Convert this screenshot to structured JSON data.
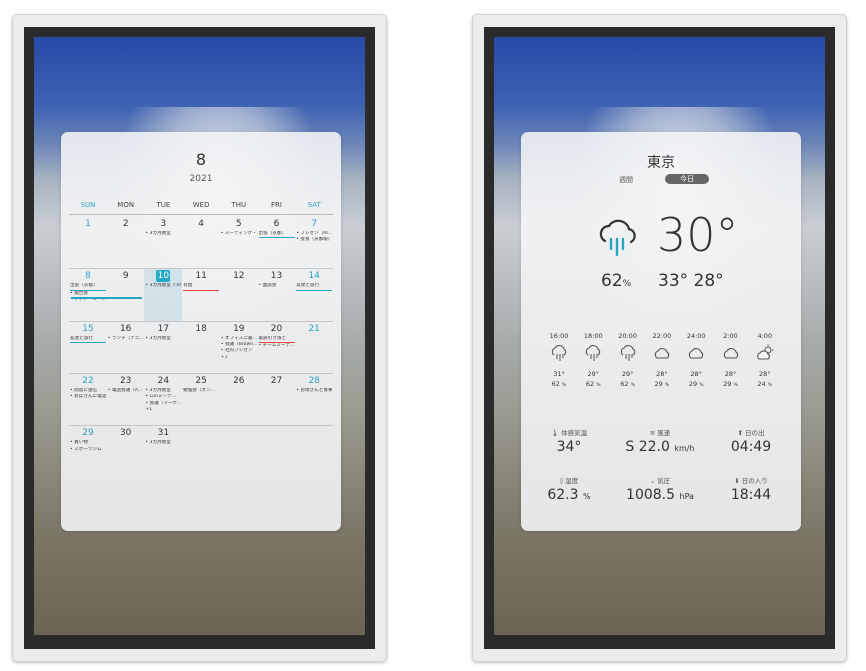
{
  "calendar": {
    "month": "8",
    "year": "2021",
    "weekdays": [
      "SUN",
      "MON",
      "TUE",
      "WED",
      "THU",
      "FRI",
      "SAT"
    ],
    "weeks": [
      [
        {
          "day": "1",
          "events": []
        },
        {
          "day": "2",
          "events": []
        },
        {
          "day": "3",
          "events": [
            "• 3カ月教室"
          ]
        },
        {
          "day": "4",
          "events": []
        },
        {
          "day": "5",
          "events": [
            "• ミーティング・"
          ]
        },
        {
          "day": "6",
          "events": [
            "出張（京都）"
          ]
        },
        {
          "day": "7",
          "events": [
            "• プレゼン（Al...",
            "• 会食（京都駅）"
          ]
        }
      ],
      [
        {
          "day": "8",
          "events": [
            "出張（京都）",
            "• 報告会",
            "• ディナーミー..."
          ]
        },
        {
          "day": "9",
          "events": []
        },
        {
          "day": "10",
          "events": [
            "• 3カ月教室 7:00a"
          ]
        },
        {
          "day": "11",
          "events": [
            "有給"
          ]
        },
        {
          "day": "12",
          "events": []
        },
        {
          "day": "13",
          "events": [
            "• 面談会"
          ]
        },
        {
          "day": "14",
          "events": [
            "友達と旅行"
          ]
        }
      ],
      [
        {
          "day": "15",
          "events": [
            "友達と旅行"
          ]
        },
        {
          "day": "16",
          "events": [
            "• ランチ（テニ..."
          ]
        },
        {
          "day": "17",
          "events": [
            "• 3カ月教室"
          ]
        },
        {
          "day": "18",
          "events": []
        },
        {
          "day": "19",
          "events": [
            "• オフィスに書...",
            "• 会議（Brown...",
            "• 社内プレゼン",
            "+1"
          ]
        },
        {
          "day": "20",
          "events": [
            "家族引き落と",
            "• チームミーテ..."
          ]
        },
        {
          "day": "21",
          "events": []
        }
      ],
      [
        {
          "day": "22",
          "events": [
            "• 間島に送信",
            "• おばさんに電話"
          ]
        },
        {
          "day": "23",
          "events": [
            "• 電話会議（A..."
          ]
        },
        {
          "day": "24",
          "events": [
            "• 3カ月教室",
            "• Lunミーテ...",
            "• 会議（マーケ...",
            "+1"
          ]
        },
        {
          "day": "25",
          "events": [
            "勉強会（オン..."
          ]
        },
        {
          "day": "26",
          "events": []
        },
        {
          "day": "27",
          "events": []
        },
        {
          "day": "28",
          "events": [
            "• お母さんと食事"
          ]
        }
      ],
      [
        {
          "day": "29",
          "events": [
            "• 買い物",
            "• スポーツジム"
          ]
        },
        {
          "day": "30",
          "events": []
        },
        {
          "day": "31",
          "events": [
            "• 3カ月教室"
          ]
        }
      ]
    ]
  },
  "weather": {
    "city": "東京",
    "tab_week": "週間",
    "tab_today": "今日",
    "current_icon": "rain-cloud-icon",
    "current_temp": "30°",
    "precip": "62",
    "precip_unit": "%",
    "hilo": "33° 28°",
    "hourly": [
      {
        "time": "16:00",
        "icon": "rain-cloud-icon",
        "temp": "31°",
        "pct": "62"
      },
      {
        "time": "18:00",
        "icon": "rain-cloud-icon",
        "temp": "29°",
        "pct": "62"
      },
      {
        "time": "20:00",
        "icon": "rain-cloud-icon",
        "temp": "29°",
        "pct": "62"
      },
      {
        "time": "22:00",
        "icon": "cloud-icon",
        "temp": "28°",
        "pct": "29"
      },
      {
        "time": "24:00",
        "icon": "cloud-icon",
        "temp": "28°",
        "pct": "29"
      },
      {
        "time": "2:00",
        "icon": "cloud-icon",
        "temp": "28°",
        "pct": "29"
      },
      {
        "time": "4:00",
        "icon": "partly-sunny-icon",
        "temp": "28°",
        "pct": "24"
      }
    ],
    "pct_unit": "%",
    "stats": [
      {
        "icon": "thermometer-icon",
        "glyph": "🌡",
        "label": "体感気温",
        "value": "34°",
        "unit": ""
      },
      {
        "icon": "wind-icon",
        "glyph": "≋",
        "label": "風速",
        "value": "S 22.0",
        "unit": "km/h"
      },
      {
        "icon": "sunrise-icon",
        "glyph": "⬆",
        "label": "日の出",
        "value": "04:49",
        "unit": ""
      },
      {
        "icon": "humidity-icon",
        "glyph": "◊",
        "label": "湿度",
        "value": "62.3",
        "unit": "%"
      },
      {
        "icon": "pressure-icon",
        "glyph": "⌄",
        "label": "気圧",
        "value": "1008.5",
        "unit": "hPa"
      },
      {
        "icon": "sunset-icon",
        "glyph": "⬇",
        "label": "日の入り",
        "value": "18:44",
        "unit": ""
      }
    ]
  },
  "colors": {
    "accent": "#2aa3c4",
    "today": "#22a9c8",
    "holiday_bar": "#e24a3a"
  }
}
